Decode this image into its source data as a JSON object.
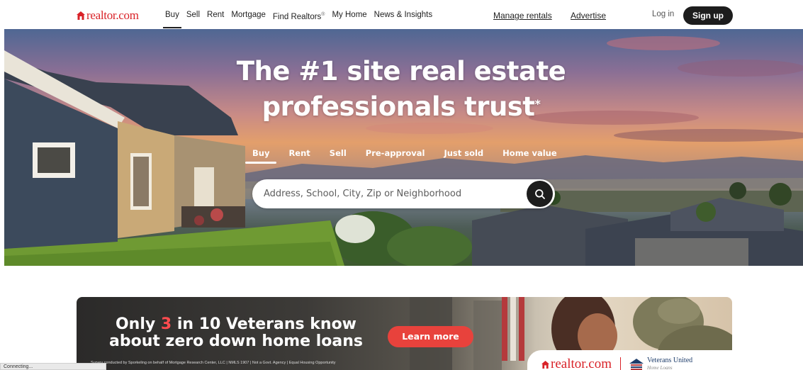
{
  "brand": {
    "logo_text": "realtor.com",
    "accent": "#d92228"
  },
  "nav": {
    "items": [
      {
        "label": "Buy",
        "active": true
      },
      {
        "label": "Sell"
      },
      {
        "label": "Rent"
      },
      {
        "label": "Mortgage"
      },
      {
        "label": "Find Realtors",
        "sup": "®"
      },
      {
        "label": "My Home"
      },
      {
        "label": "News & Insights"
      }
    ],
    "manage_rentals": "Manage rentals",
    "advertise": "Advertise",
    "login": "Log in",
    "signup": "Sign up"
  },
  "hero": {
    "headline_line1": "The #1 site real estate",
    "headline_line2": "professionals trust",
    "asterisk": "*",
    "tabs": [
      "Buy",
      "Rent",
      "Sell",
      "Pre-approval",
      "Just sold",
      "Home value"
    ],
    "active_tab": "Buy",
    "search_placeholder": "Address, School, City, Zip or Neighborhood"
  },
  "banner": {
    "title_pre": "Only ",
    "title_highlight": "3",
    "title_post": " in 10 Veterans know",
    "title_line2": "about zero down home loans",
    "highlight_color": "#ff4b4f",
    "cta": "Learn more",
    "disclaimer": "Survey conducted by Sporkeling on behalf of Mortgage Research Center, LLC | NMLS 1907 | Not a Govt. Agency | Equal Housing Opportunity",
    "cobrand_logo": "realtor.com",
    "partner_name": "Veterans United",
    "partner_sub": "Home Loans"
  },
  "status": "Connecting..."
}
